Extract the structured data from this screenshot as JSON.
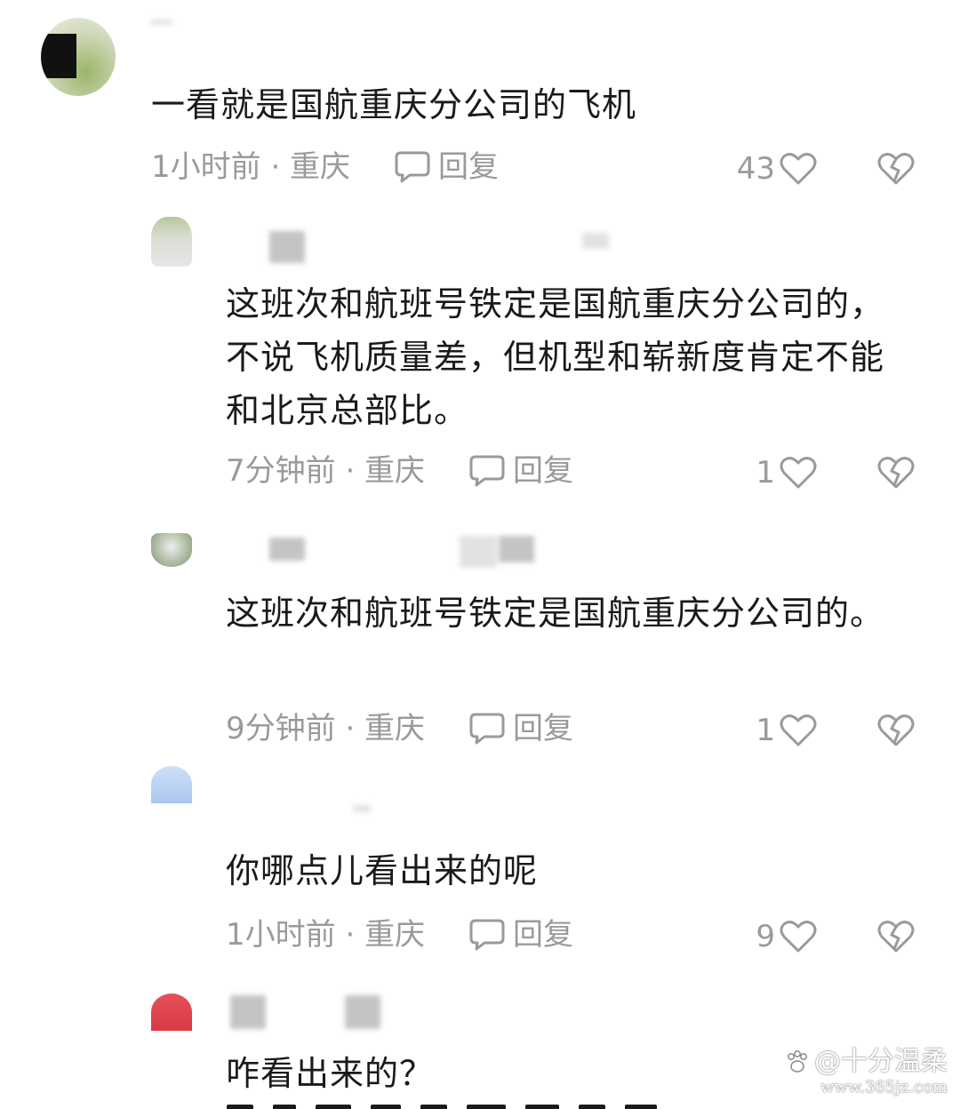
{
  "comments": [
    {
      "text": "一看就是国航重庆分公司的飞机",
      "meta": "1小时前 · 重庆",
      "reply_label": "回复",
      "likes": "43"
    },
    {
      "text": "这班次和航班号铁定是国航重庆分公司的，不说飞机质量差，但机型和崭新度肯定不能和北京总部比。",
      "meta": "7分钟前 · 重庆",
      "reply_label": "回复",
      "likes": "1"
    },
    {
      "text": "这班次和航班号铁定是国航重庆分公司的。",
      "meta": "9分钟前 · 重庆",
      "reply_label": "回复",
      "likes": "1"
    },
    {
      "text": "你哪点儿看出来的呢",
      "meta": "1小时前 · 重庆",
      "reply_label": "回复",
      "likes": "9"
    },
    {
      "text": "咋看出来的？",
      "meta": "",
      "reply_label": "",
      "likes": ""
    }
  ],
  "watermark": {
    "label": "@十分温柔",
    "url": "www.365jz.com"
  },
  "icons": {
    "reply": "comment-bubble-icon",
    "like": "heart-icon",
    "dislike": "broken-heart-icon",
    "watermark": "paw-icon"
  },
  "colors": {
    "meta_gray": "#9a9a9a",
    "text": "#1a1a1a"
  }
}
